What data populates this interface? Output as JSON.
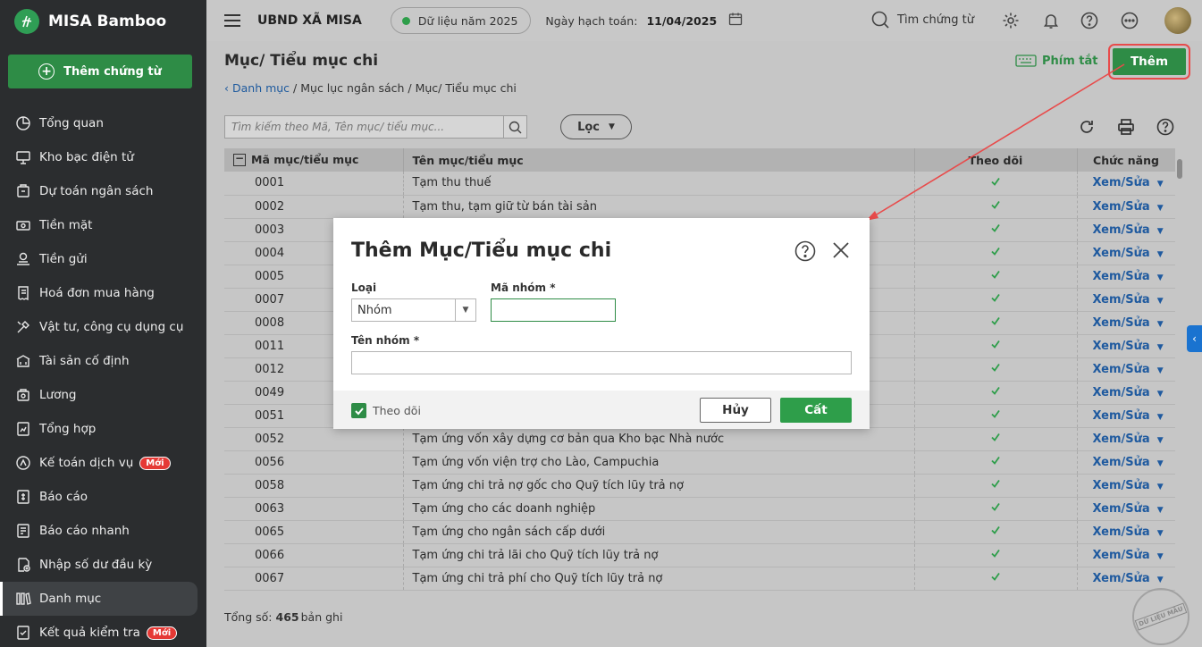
{
  "app": {
    "name": "MISA Bamboo"
  },
  "sidebar": {
    "add_voucher_label": "Thêm chứng từ",
    "new_badge": "Mới",
    "items": [
      {
        "label": "Tổng quan",
        "icon": "pie-chart-icon"
      },
      {
        "label": "Kho bạc điện tử",
        "icon": "monitor-icon"
      },
      {
        "label": "Dự toán ngân sách",
        "icon": "budget-icon"
      },
      {
        "label": "Tiền mặt",
        "icon": "cash-icon"
      },
      {
        "label": "Tiền gửi",
        "icon": "deposit-icon"
      },
      {
        "label": "Hoá đơn mua hàng",
        "icon": "invoice-icon"
      },
      {
        "label": "Vật tư, công cụ dụng cụ",
        "icon": "tools-icon"
      },
      {
        "label": "Tài sản cố định",
        "icon": "bank-icon"
      },
      {
        "label": "Lương",
        "icon": "salary-icon"
      },
      {
        "label": "Tổng hợp",
        "icon": "summary-icon"
      },
      {
        "label": "Kế toán dịch vụ",
        "icon": "service-icon"
      },
      {
        "label": "Báo cáo",
        "icon": "report-icon"
      },
      {
        "label": "Báo cáo nhanh",
        "icon": "quick-report-icon"
      },
      {
        "label": "Nhập số dư đầu kỳ",
        "icon": "opening-balance-icon"
      },
      {
        "label": "Danh mục",
        "icon": "catalog-icon"
      },
      {
        "label": "Kết quả kiểm tra",
        "icon": "check-result-icon"
      }
    ]
  },
  "header": {
    "org_name": "UBND XÃ MISA",
    "data_year": "Dữ liệu năm 2025",
    "posting_date_label": "Ngày hạch toán:",
    "posting_date": "11/04/2025",
    "search_label": "Tìm chứng từ"
  },
  "page": {
    "title": "Mục/ Tiểu mục chi",
    "breadcrumb_link": "Danh mục",
    "breadcrumb_rest": "/ Mục lục ngân sách / Mục/ Tiểu mục chi",
    "shortcut_label": "Phím tắt",
    "add_label": "Thêm",
    "search_placeholder": "Tìm kiếm theo Mã, Tên mục/ tiểu mục...",
    "filter_label": "Lọc"
  },
  "table": {
    "columns": [
      "Mã mục/tiểu mục",
      "Tên mục/tiểu mục",
      "Theo dõi",
      "Chức năng"
    ],
    "action_label": "Xem/Sửa",
    "rows": [
      {
        "code": "0001",
        "name": "Tạm thu thuế"
      },
      {
        "code": "0002",
        "name": "Tạm thu, tạm giữ từ bán tài sản"
      },
      {
        "code": "0003",
        "name": ""
      },
      {
        "code": "0004",
        "name": ""
      },
      {
        "code": "0005",
        "name": ""
      },
      {
        "code": "0007",
        "name": ""
      },
      {
        "code": "0008",
        "name": ""
      },
      {
        "code": "0011",
        "name": ""
      },
      {
        "code": "0012",
        "name": ""
      },
      {
        "code": "0049",
        "name": ""
      },
      {
        "code": "0051",
        "name": ""
      },
      {
        "code": "0052",
        "name": "Tạm ứng vốn xây dựng cơ bản qua Kho bạc Nhà nước"
      },
      {
        "code": "0056",
        "name": "Tạm ứng vốn viện trợ cho Lào, Campuchia"
      },
      {
        "code": "0058",
        "name": "Tạm ứng chi trả nợ gốc cho Quỹ tích lũy trả nợ"
      },
      {
        "code": "0063",
        "name": "Tạm ứng cho các doanh nghiệp"
      },
      {
        "code": "0065",
        "name": "Tạm ứng cho ngân sách cấp dưới"
      },
      {
        "code": "0066",
        "name": "Tạm ứng chi trả lãi cho Quỹ tích lũy trả nợ"
      },
      {
        "code": "0067",
        "name": "Tạm ứng chi trả phí cho Quỹ tích lũy trả nợ"
      }
    ],
    "total_label": "Tổng số:",
    "total_count": "465",
    "total_suffix": "bản ghi"
  },
  "stamp_text": "DỮ LIỆU MẪU",
  "modal": {
    "title": "Thêm Mục/Tiểu mục chi",
    "type_label": "Loại",
    "type_value": "Nhóm",
    "group_code_label": "Mã nhóm *",
    "group_code_value": "",
    "group_name_label": "Tên nhóm *",
    "group_name_value": "",
    "track_label": "Theo dõi",
    "track_checked": true,
    "cancel_label": "Hủy",
    "save_label": "Cất"
  },
  "colors": {
    "primary": "#2e8c46",
    "link": "#1f5a9f",
    "highlight": "#e84b4b"
  }
}
